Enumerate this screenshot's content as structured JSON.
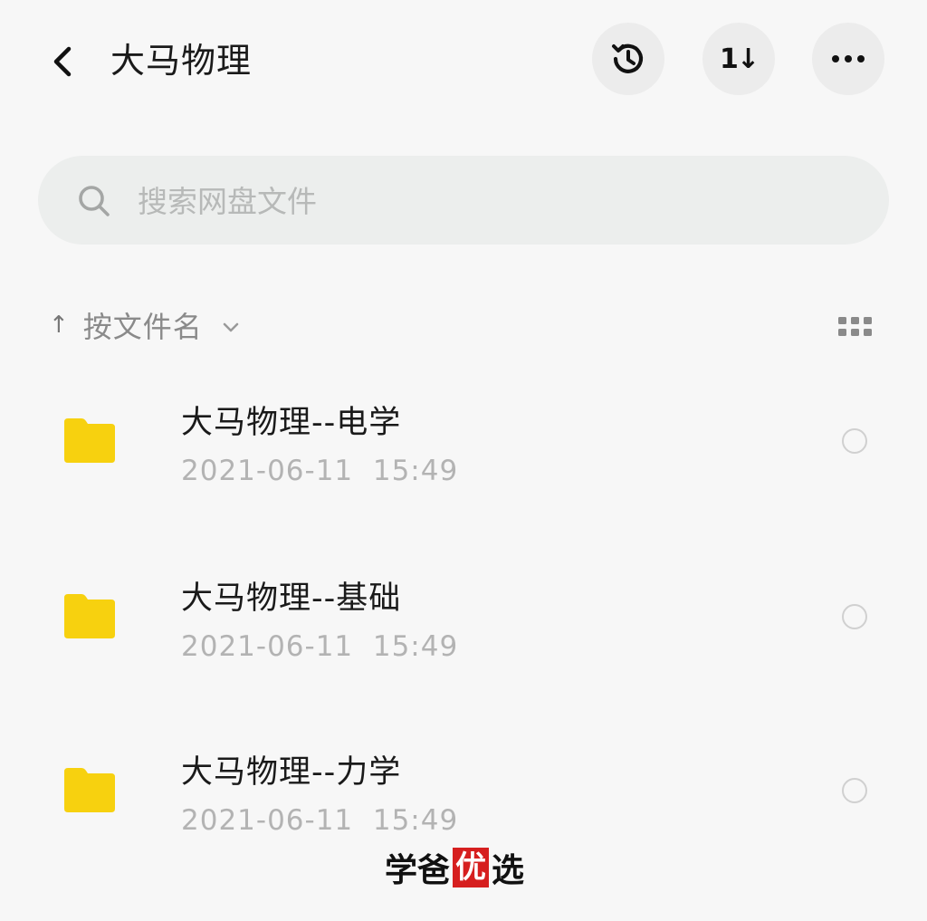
{
  "header": {
    "title": "大马物理",
    "icons": {
      "back": "chevron-left-icon",
      "history": "history-icon",
      "sort": "sort-icon",
      "more": "more-icon"
    },
    "sort_glyph": "1↓"
  },
  "search": {
    "placeholder": "搜索网盘文件",
    "value": ""
  },
  "sort_bar": {
    "arrow": "↑",
    "label": "按文件名"
  },
  "files": [
    {
      "name": "大马物理--电学",
      "date": "2021-06-11  15:49"
    },
    {
      "name": "大马物理--基础",
      "date": "2021-06-11  15:49"
    },
    {
      "name": "大马物理--力学",
      "date": "2021-06-11  15:49"
    }
  ],
  "watermark": {
    "pre": "学爸",
    "seal": "优",
    "post": "选"
  },
  "colors": {
    "folder": "#f7d10f",
    "background": "#f7f7f7",
    "search_bg": "#eceeed",
    "button_bg": "#ececec",
    "seal": "#d61f1f"
  }
}
